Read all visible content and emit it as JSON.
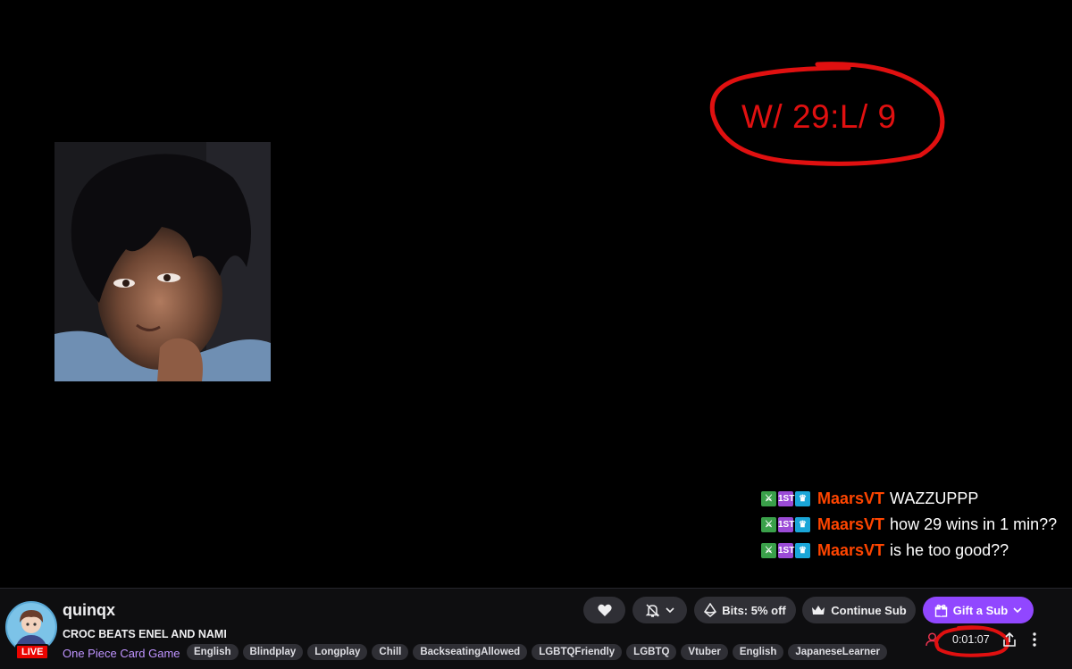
{
  "overlay": {
    "score_text": "W/ 29:L/ 9",
    "score_color": "#e01010"
  },
  "chat": {
    "user_color": "#ff4500",
    "badge_first_label": "1ST",
    "messages": [
      {
        "user": "MaarsVT",
        "text": "WAZZUPPP"
      },
      {
        "user": "MaarsVT",
        "text": "how 29 wins in 1 min??"
      },
      {
        "user": "MaarsVT",
        "text": "is he too good??"
      }
    ]
  },
  "channel": {
    "name": "quinqx",
    "live_label": "LIVE",
    "stream_title": "CROC BEATS ENEL AND NAMI",
    "category": "One Piece Card Game",
    "tags": [
      "English",
      "Blindplay",
      "Longplay",
      "Chill",
      "BackseatingAllowed",
      "LGBTQFriendly",
      "LGBTQ",
      "Vtuber",
      "English",
      "JapaneseLearner"
    ]
  },
  "actions": {
    "follow_icon": "heart-icon",
    "notifications_icon": "bell-off-icon",
    "bits_label": "Bits: 5% off",
    "continue_sub_label": "Continue Sub",
    "gift_sub_label": "Gift a Sub",
    "accent_color": "#9147ff"
  },
  "stats": {
    "uptime": "0:01:07"
  }
}
